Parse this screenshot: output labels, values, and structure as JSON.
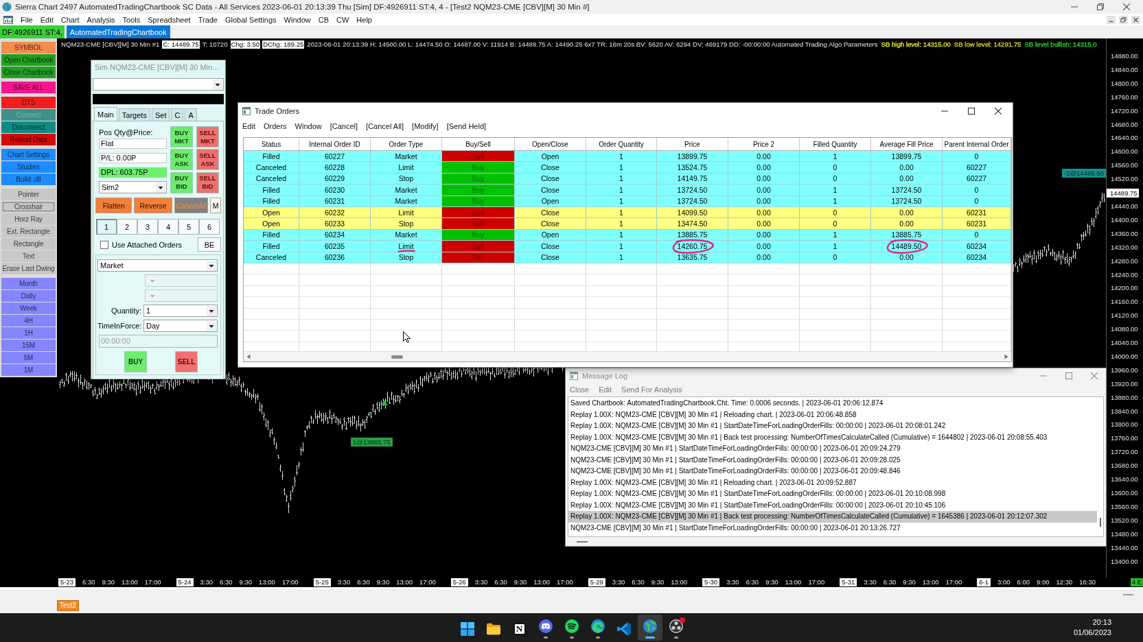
{
  "window": {
    "title": "Sierra Chart 2497 AutomatedTradingChartbook SC Data - All Services 2023-06-01 20:13:39 Thu [Sim] DF:4926911 ST:4, 4 - [Test2 NQM23-CME [CBV][M] 30 Min #]"
  },
  "menu": [
    "File",
    "Edit",
    "Chart",
    "Analysis",
    "Tools",
    "Spreadsheet",
    "Trade",
    "Global Settings",
    "Window",
    "CB",
    "CW",
    "Help"
  ],
  "chartbook_bar": {
    "status": "DF:4926911 ST:4,",
    "tabs": [
      {
        "label": "AutomatedTradingChartbook",
        "selected": true
      }
    ]
  },
  "sidebar": {
    "groups": [
      {
        "buttons": [
          {
            "label": "SYMBOL",
            "color": "#f58b4c",
            "disabled": false
          },
          {
            "label": "Open Chartbook",
            "color": "#22a022",
            "disabled": false
          },
          {
            "label": "Close Chartbook",
            "color": "#22a022",
            "disabled": false
          }
        ]
      },
      {
        "buttons": [
          {
            "label": "SAVE ALL",
            "color": "#f3168f",
            "disabled": false
          }
        ]
      },
      {
        "buttons": [
          {
            "label": "DTS",
            "color": "#f41e1e",
            "disabled": false
          },
          {
            "label": "Connect",
            "color": "#3f8f8a",
            "disabled": true
          },
          {
            "label": "Disconnect",
            "color": "#0f8c84",
            "disabled": false
          },
          {
            "label": "Reload Data",
            "color": "#d40a0a",
            "disabled": false
          }
        ]
      },
      {
        "buttons": [
          {
            "label": "Chart Settings",
            "color": "#1e8cff",
            "disabled": false
          },
          {
            "label": "Studies",
            "color": "#1e8cff",
            "disabled": false
          },
          {
            "label": "Build .dll",
            "color": "#1e8cff",
            "disabled": false
          }
        ]
      },
      {
        "buttons": [
          {
            "label": "Pointer",
            "color": "#c8c8c8",
            "disabled": false,
            "selected": false
          },
          {
            "label": "Crosshair",
            "color": "#c8c8c8",
            "disabled": false,
            "selected": true
          },
          {
            "label": "Horz Ray",
            "color": "#c8c8c8",
            "disabled": false,
            "selected": false
          },
          {
            "label": "Ext. Rectangle",
            "color": "#c8c8c8",
            "disabled": false,
            "selected": false
          },
          {
            "label": "Rectangle",
            "color": "#c8c8c8",
            "disabled": false,
            "selected": false
          },
          {
            "label": "Text",
            "color": "#c8c8c8",
            "disabled": false,
            "selected": false
          },
          {
            "label": "Erase Last Dwing",
            "color": "#c8c8c8",
            "disabled": false,
            "selected": false
          }
        ]
      },
      {
        "buttons": [
          {
            "label": "Month",
            "color": "#8585ff",
            "disabled": false
          },
          {
            "label": "Daily",
            "color": "#8585ff",
            "disabled": false
          },
          {
            "label": "Week",
            "color": "#8585ff",
            "disabled": false
          },
          {
            "label": "4H",
            "color": "#8585ff",
            "disabled": false
          },
          {
            "label": "1H",
            "color": "#8585ff",
            "disabled": false
          },
          {
            "label": "15M",
            "color": "#8585ff",
            "disabled": false
          },
          {
            "label": "5M",
            "color": "#8585ff",
            "disabled": false
          },
          {
            "label": "1M",
            "color": "#8585ff",
            "disabled": false
          }
        ]
      }
    ]
  },
  "chart": {
    "header": [
      {
        "text": "NQM23-CME [CBV][M] 30 Min #1",
        "kind": "plain"
      },
      {
        "text": "C: 14489.75",
        "kind": "boxed"
      },
      {
        "text": "T: 10720",
        "kind": "plain"
      },
      {
        "text": "Chg: 3.50",
        "kind": "boxed"
      },
      {
        "text": "DChg: 189.25",
        "kind": "boxed"
      },
      {
        "text": "2023-06-01 20:13:39 H: 14500.00 L: 14474.50 O: 14487.00 V: 11914 B: 14489.75 A: 14490.25 6x7 TR: 16m 20s BV: 5620 AV: 6294 DV: 469179 DD: -00:00:00 Automated Trading Algo Parameters",
        "kind": "plain"
      },
      {
        "text": "SB high level: 14315.00",
        "kind": "colored",
        "color": "#e6e619"
      },
      {
        "text": "SB low level: 14291.75",
        "kind": "colored",
        "color": "#d2d21e"
      },
      {
        "text": "SB level bullish: 14315.0",
        "kind": "colored",
        "color": "#2bd62b"
      }
    ],
    "fill_labels": [
      {
        "text": "1@13885.75",
        "kind": "buy"
      },
      {
        "text": "-1@14489.50",
        "kind": "sell"
      }
    ],
    "price_axis": {
      "labels_above": [
        "14880.00",
        "14840.00",
        "14800.00",
        "14760.00",
        "14720.00",
        "14680.00",
        "14640.00",
        "14600.00",
        "14560.00",
        "14520.00"
      ],
      "current_price": "14489.75",
      "labels_below": [
        "14440.00",
        "14400.00",
        "14360.00",
        "14320.00",
        "14280.00",
        "14240.00",
        "14200.00",
        "14160.00",
        "14120.00",
        "14080.00",
        "14040.00",
        "14000.00",
        "13960.00",
        "13920.00",
        "13880.00",
        "13840.00",
        "13800.00",
        "13760.00",
        "13720.00",
        "13680.00",
        "13640.00",
        "13600.00",
        "13560.00",
        "13520.00",
        "13480.00",
        "13440.00",
        "13400.00"
      ]
    },
    "time_axis": {
      "days": [
        {
          "date": "5-23",
          "times": [
            "6:30",
            "9:30",
            "13:00",
            "17:00"
          ]
        },
        {
          "date": "5-24",
          "times": [
            "3:30",
            "6:30",
            "9:30",
            "13:00",
            "17:00"
          ]
        },
        {
          "date": "5-25",
          "times": [
            "3:30",
            "6:30",
            "9:30",
            "13:00",
            "17:00"
          ]
        },
        {
          "date": "5-26",
          "times": [
            "3:30",
            "6:30",
            "9:30",
            "13:00",
            "17:00"
          ]
        },
        {
          "date": "5-29",
          "times": [
            "3:30",
            "6:30",
            "9:30",
            "13:00"
          ]
        },
        {
          "date": "5-30",
          "times": [
            "3:30",
            "6:30",
            "9:30",
            "13:00",
            "17:00"
          ]
        },
        {
          "date": "5-31",
          "times": [
            "3:30",
            "6:30",
            "9:30",
            "13:00",
            "17:00"
          ]
        },
        {
          "date": "6-1",
          "times": [
            "3:00",
            "6:00",
            "9:00",
            "12:30",
            "16:30"
          ]
        }
      ],
      "badge": "4 E"
    },
    "tab": "Test2"
  },
  "sim_order_window": {
    "title": "Sim NQM23-CME [CBV][M] 30 Min...",
    "tabs": [
      {
        "label": "Main",
        "selected": true
      },
      {
        "label": "Targets",
        "selected": false
      },
      {
        "label": "Set",
        "selected": false
      },
      {
        "label": "C",
        "selected": false
      },
      {
        "label": "A",
        "selected": false
      }
    ],
    "position_label": "Pos Qty@Price:",
    "position": "Flat",
    "profit_loss": "P/L: 0.00P",
    "daily_profit_loss": "DPL: 603.75P",
    "account": "Sim2",
    "order_buttons": [
      {
        "label": "BUY MKT",
        "kind": "buy"
      },
      {
        "label": "SELL MKT",
        "kind": "sell"
      },
      {
        "label": "BUY ASK",
        "kind": "buy"
      },
      {
        "label": "SELL ASK",
        "kind": "sell"
      },
      {
        "label": "BUY BID",
        "kind": "buy"
      },
      {
        "label": "SELL BID",
        "kind": "sell"
      }
    ],
    "action_buttons": [
      {
        "label": "Flatten",
        "kind": "orange"
      },
      {
        "label": "Reverse",
        "kind": "orange"
      },
      {
        "label": "CancelAll",
        "kind": "gray"
      },
      {
        "label": "M",
        "kind": "plain"
      }
    ],
    "quantity_presets": [
      {
        "label": "1",
        "selected": true
      },
      {
        "label": "2",
        "selected": false
      },
      {
        "label": "3",
        "selected": false
      },
      {
        "label": "4",
        "selected": false
      },
      {
        "label": "5",
        "selected": false
      },
      {
        "label": "6",
        "selected": false
      }
    ],
    "attached_orders": {
      "label": "Use Attached Orders",
      "checked": false
    },
    "breakeven_button": "BE",
    "order_type": "Market",
    "extra_dropdowns": [
      {
        "disabled": true
      },
      {
        "disabled": true
      }
    ],
    "quantity_label": "Quantity:",
    "quantity": "1",
    "time_in_force_label": "TimeInForce:",
    "time_in_force": "Day",
    "time_field": {
      "value": "00:00:00",
      "disabled": true
    },
    "buy_button": "BUY",
    "sell_button": "SELL"
  },
  "trade_orders": {
    "title": "Trade Orders",
    "menu": [
      "Edit",
      "Orders",
      "Window",
      "[Cancel]",
      "[Cancel All]",
      "[Modify]",
      "[Send Held]"
    ],
    "columns": [
      "Status",
      "Internal Order ID",
      "Order Type",
      "Buy/Sell",
      "Open/Close",
      "Order Quantity",
      "Price",
      "Price 2",
      "Filled Quantity",
      "Average Fill Price",
      "Parent Internal Order"
    ],
    "rows": [
      {
        "status": "Filled",
        "order_id": "60227",
        "order_type": "Market",
        "side": {
          "label": "Sell",
          "color": "#cc0000"
        },
        "open_close": "Open",
        "quantity": "1",
        "price": "13899.75",
        "price_2": "0.00",
        "filled_quantity": "1",
        "average_fill_price": "13899.75",
        "parent_order": "0",
        "color": "#80ffff",
        "circled": false,
        "underlined": false
      },
      {
        "status": "Canceled",
        "order_id": "60228",
        "order_type": "Limit",
        "side": {
          "label": "Buy",
          "color": "#00c000"
        },
        "open_close": "Close",
        "quantity": "1",
        "price": "13524.75",
        "price_2": "0.00",
        "filled_quantity": "0",
        "average_fill_price": "0.00",
        "parent_order": "60227",
        "color": "#80ffff",
        "circled": false,
        "underlined": false
      },
      {
        "status": "Canceled",
        "order_id": "60229",
        "order_type": "Stop",
        "side": {
          "label": "Buy",
          "color": "#00c000"
        },
        "open_close": "Close",
        "quantity": "1",
        "price": "14149.75",
        "price_2": "0.00",
        "filled_quantity": "0",
        "average_fill_price": "0.00",
        "parent_order": "60227",
        "color": "#80ffff",
        "circled": false,
        "underlined": false
      },
      {
        "status": "Filled",
        "order_id": "60230",
        "order_type": "Market",
        "side": {
          "label": "Buy",
          "color": "#00c000"
        },
        "open_close": "Close",
        "quantity": "1",
        "price": "13724.50",
        "price_2": "0.00",
        "filled_quantity": "1",
        "average_fill_price": "13724.50",
        "parent_order": "0",
        "color": "#80ffff",
        "circled": false,
        "underlined": false
      },
      {
        "status": "Filled",
        "order_id": "60231",
        "order_type": "Market",
        "side": {
          "label": "Buy",
          "color": "#00c000"
        },
        "open_close": "Open",
        "quantity": "1",
        "price": "13724.50",
        "price_2": "0.00",
        "filled_quantity": "1",
        "average_fill_price": "13724.50",
        "parent_order": "0",
        "color": "#80ffff",
        "circled": false,
        "underlined": false
      },
      {
        "status": "Open",
        "order_id": "60232",
        "order_type": "Limit",
        "side": {
          "label": "Sell",
          "color": "#cc0000"
        },
        "open_close": "Close",
        "quantity": "1",
        "price": "14099.50",
        "price_2": "0.00",
        "filled_quantity": "0",
        "average_fill_price": "0.00",
        "parent_order": "60231",
        "color": "#ffff80",
        "circled": false,
        "underlined": false
      },
      {
        "status": "Open",
        "order_id": "60233",
        "order_type": "Stop",
        "side": {
          "label": "Sell",
          "color": "#cc0000"
        },
        "open_close": "Close",
        "quantity": "1",
        "price": "13474.50",
        "price_2": "0.00",
        "filled_quantity": "0",
        "average_fill_price": "0.00",
        "parent_order": "60231",
        "color": "#ffff80",
        "circled": false,
        "underlined": false
      },
      {
        "status": "Filled",
        "order_id": "60234",
        "order_type": "Market",
        "side": {
          "label": "Buy",
          "color": "#00c000"
        },
        "open_close": "Open",
        "quantity": "1",
        "price": "13885.75",
        "price_2": "0.00",
        "filled_quantity": "1",
        "average_fill_price": "13885.75",
        "parent_order": "0",
        "color": "#80ffff",
        "circled": false,
        "underlined": false
      },
      {
        "status": "Filled",
        "order_id": "60235",
        "order_type": "Limit",
        "side": {
          "label": "Sell",
          "color": "#cc0000"
        },
        "open_close": "Close",
        "quantity": "1",
        "price": "14260.75",
        "price_2": "0.00",
        "filled_quantity": "1",
        "average_fill_price": "14489.50",
        "parent_order": "60234",
        "color": "#80ffff",
        "circled": true,
        "underlined": true
      },
      {
        "status": "Canceled",
        "order_id": "60236",
        "order_type": "Stop",
        "side": {
          "label": "Sell",
          "color": "#cc0000"
        },
        "open_close": "Close",
        "quantity": "1",
        "price": "13635.75",
        "price_2": "0.00",
        "filled_quantity": "0",
        "average_fill_price": "0.00",
        "parent_order": "60234",
        "color": "#80ffff",
        "circled": false,
        "underlined": false
      }
    ]
  },
  "message_log": {
    "title": "Message Log",
    "menu": [
      "Close",
      "Edit",
      "Send For Analysis"
    ],
    "lines": [
      {
        "text": "Saved Chartbook: AutomatedTradingChartbook.Cht. Time: 0.0006 seconds. | 2023-06-01 20:06:12.874",
        "selected": false
      },
      {
        "text": "Replay 1.00X: NQM23-CME [CBV][M] 30 Min #1 | Reloading chart. | 2023-06-01 20:06:48.858",
        "selected": false
      },
      {
        "text": "Replay 1.00X: NQM23-CME [CBV][M] 30 Min #1 | StartDateTimeForLoadingOrderFills: 00:00:00 | 2023-06-01 20:08:01.242",
        "selected": false
      },
      {
        "text": "Replay 1.00X: NQM23-CME [CBV][M] 30 Min #1 | Back test processing: NumberOfTimesCalculateCalled (Cumulative) = 1644802 | 2023-06-01 20:08:55.403",
        "selected": false
      },
      {
        "text": "NQM23-CME [CBV][M] 30 Min #1 | StartDateTimeForLoadingOrderFills: 00:00:00 | 2023-06-01 20:09:24.279",
        "selected": false
      },
      {
        "text": "NQM23-CME [CBV][M] 30 Min #1 | StartDateTimeForLoadingOrderFills: 00:00:00 | 2023-06-01 20:09:28.025",
        "selected": false
      },
      {
        "text": "NQM23-CME [CBV][M] 30 Min #1 | StartDateTimeForLoadingOrderFills: 00:00:00 | 2023-06-01 20:09:48.846",
        "selected": false
      },
      {
        "text": "Replay 1.00X: NQM23-CME [CBV][M] 30 Min #1 | Reloading chart. | 2023-06-01 20:09:52.887",
        "selected": false
      },
      {
        "text": "Replay 1.00X: NQM23-CME [CBV][M] 30 Min #1 | StartDateTimeForLoadingOrderFills: 00:00:00 | 2023-06-01 20:10:08.998",
        "selected": false
      },
      {
        "text": "Replay 1.00X: NQM23-CME [CBV][M] 30 Min #1 | StartDateTimeForLoadingOrderFills: 00:00:00 | 2023-06-01 20:10:45.106",
        "selected": false
      },
      {
        "text": "Replay 1.00X: NQM23-CME [CBV][M] 30 Min #1 | Back test processing: NumberOfTimesCalculateCalled (Cumulative) = 1645386 | 2023-06-01 20:12:07.302",
        "selected": true
      },
      {
        "text": "NQM23-CME [CBV][M] 30 Min #1 | StartDateTimeForLoadingOrderFills: 00:00:00 | 2023-06-01 20:13:26.727",
        "selected": false
      }
    ]
  },
  "taskbar": {
    "apps": [
      {
        "kind": "start",
        "running": false,
        "active": false,
        "notification": false
      },
      {
        "kind": "folder",
        "running": false,
        "active": false,
        "notification": false
      },
      {
        "kind": "letter",
        "glyph": "N",
        "running": false,
        "active": false,
        "notification": false
      },
      {
        "kind": "gamepad",
        "running": true,
        "active": false,
        "notification": false
      },
      {
        "kind": "waves",
        "running": true,
        "active": false,
        "notification": false
      },
      {
        "kind": "swirl",
        "running": true,
        "active": false,
        "notification": false
      },
      {
        "kind": "ribbon",
        "running": false,
        "active": false,
        "notification": false
      },
      {
        "kind": "globe",
        "running": true,
        "active": true,
        "notification": false
      },
      {
        "kind": "circles",
        "running": true,
        "active": false,
        "notification": true
      }
    ],
    "time": "20:13",
    "date": "01/06/2023"
  }
}
